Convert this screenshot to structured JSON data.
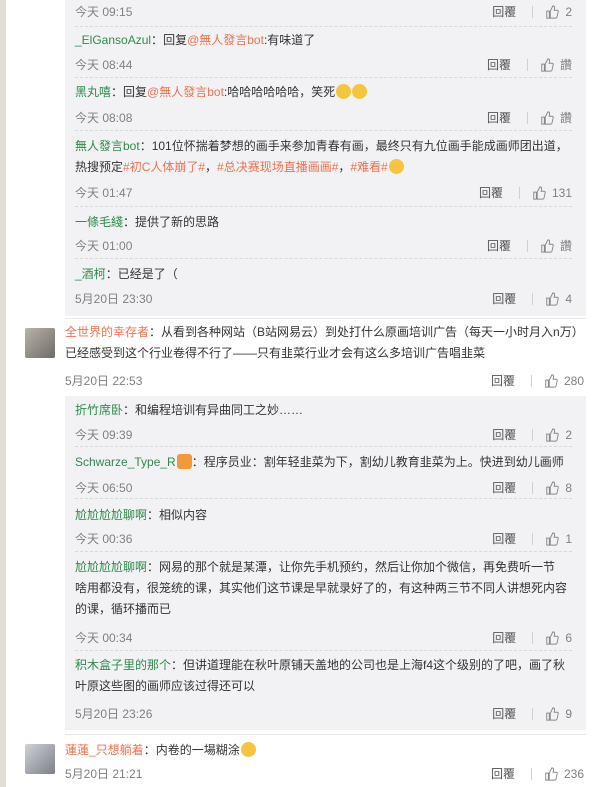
{
  "reply_label": "回覆",
  "like_placeholder": "讚",
  "thread1": {
    "replies": [
      {
        "time": "今天 09:15",
        "likes": "2"
      },
      {
        "name": "_ElGansoAzul",
        "sep": "：",
        "pre": "回复",
        "at": "@無人發言bot",
        "body": ":有味道了",
        "time": "今天 08:44",
        "likes": "讚"
      },
      {
        "name": "黑丸嘻",
        "sep": "：",
        "pre": "回复",
        "at": "@無人發言bot",
        "body": ":哈哈哈哈哈哈，笑死",
        "time": "今天 08:08",
        "likes": "讚"
      },
      {
        "name": "無人發言bot",
        "sep": "：",
        "line1": "101位怀揣着梦想的画手来参加青春有画，最终只有九位画手能成画师团出道，",
        "line2_pre": "热搜预定",
        "topic1": "#初C人体崩了#",
        "mid": "，",
        "topic2": "#总决赛现场直播画画#",
        "mid2": "，",
        "topic3": "#难看#",
        "time": "今天 01:47",
        "likes": "131"
      },
      {
        "name": "一條毛綫",
        "sep": "：",
        "body": "提供了新的思路",
        "time": "今天 01:00",
        "likes": "讚"
      },
      {
        "name": "_酒柯",
        "sep": "：",
        "body": "已经是了（",
        "time": "5月20日 23:30",
        "likes": "4"
      }
    ]
  },
  "comment2": {
    "name": "全世界的幸存者",
    "sep": "：",
    "line1": "从看到各种网站（B站网易云）到处打什么原画培训广告（每天一小时月入n万）",
    "line2": "已经感受到这个行业卷得不行了——只有韭菜行业才会有这么多培训广告唱韭菜",
    "time": "5月20日 22:53",
    "likes": "280"
  },
  "thread2": {
    "replies": [
      {
        "name": "折竹席卧",
        "sep": "：",
        "body": "和编程培训有异曲同工之妙……",
        "time": "今天 09:39",
        "likes": "2"
      },
      {
        "name": "Schwarze_Type_R",
        "sep": "：",
        "body": "程序员业：割年轻韭菜为下，割幼儿教育韭菜为上。快进到幼儿画师",
        "time": "今天 06:50",
        "likes": "8"
      },
      {
        "name": "尬尬尬尬聊啊",
        "sep": "：",
        "body": "相似内容",
        "time": "今天 00:36",
        "likes": "1"
      },
      {
        "name": "尬尬尬尬聊啊",
        "sep": "：",
        "line1": "网易的那个就是某潭，让你先手机预约，然后让你加个微信，再免费听一节",
        "line2": "啥用都没有，很笼统的课，其实他们这节课是早就录好了的，有这种两三节不同人讲想死内容",
        "line3": "的课，循环播而已",
        "time": "今天 00:34",
        "likes": "6"
      },
      {
        "name": "积木盒子里的那个",
        "sep": "：",
        "line1": "但讲道理能在秋叶原铺天盖地的公司也是上海f4这个级别的了吧，画了秋",
        "line2": "叶原这些图的画师应该过得还可以",
        "time": "5月20日 23:26",
        "likes": "9"
      }
    ]
  },
  "comment3": {
    "name": "蓮蓮_只想躺着",
    "sep": "：",
    "body": "内卷的一場糊涂",
    "time": "5月20日 21:21",
    "likes": "236"
  },
  "colors": {
    "name": "#eb7350",
    "green_name": "#2f8a4a",
    "panel": "#f2f2f5",
    "meta": "#808080"
  }
}
